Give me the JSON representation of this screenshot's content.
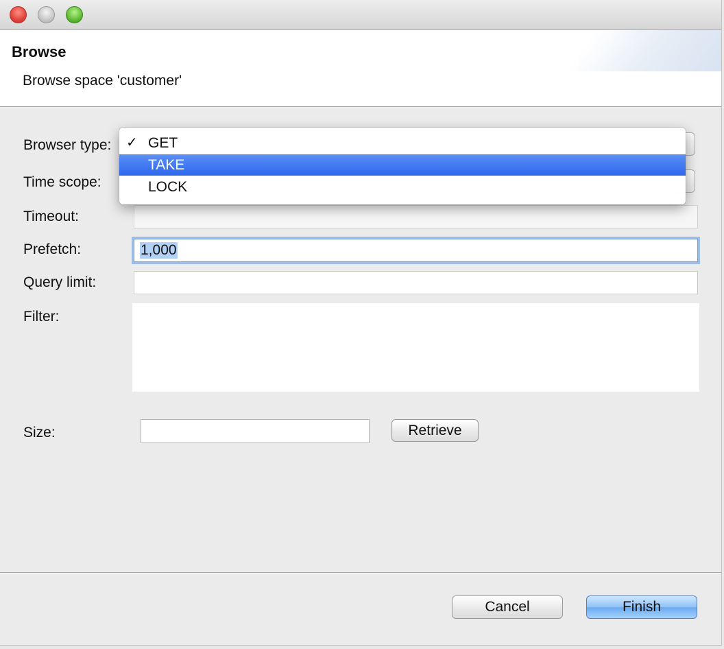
{
  "header": {
    "title": "Browse",
    "subtitle": "Browse space 'customer'"
  },
  "form": {
    "browser_type_label": "Browser type:",
    "time_scope_label": "Time scope:",
    "timeout_label": "Timeout:",
    "timeout_value": "",
    "prefetch_label": "Prefetch:",
    "prefetch_value": "1,000",
    "query_limit_label": "Query limit:",
    "query_limit_value": "",
    "filter_label": "Filter:",
    "filter_value": "",
    "size_label": "Size:",
    "size_value": "",
    "retrieve_label": "Retrieve"
  },
  "dropdown": {
    "items": [
      {
        "label": "GET",
        "checked": true,
        "highlighted": false
      },
      {
        "label": "TAKE",
        "checked": false,
        "highlighted": true
      },
      {
        "label": "LOCK",
        "checked": false,
        "highlighted": false
      }
    ],
    "checkmark": "✓"
  },
  "footer": {
    "cancel_label": "Cancel",
    "finish_label": "Finish"
  },
  "colors": {
    "highlight": "#2d67ee",
    "focus_ring": "#9bbde6"
  }
}
